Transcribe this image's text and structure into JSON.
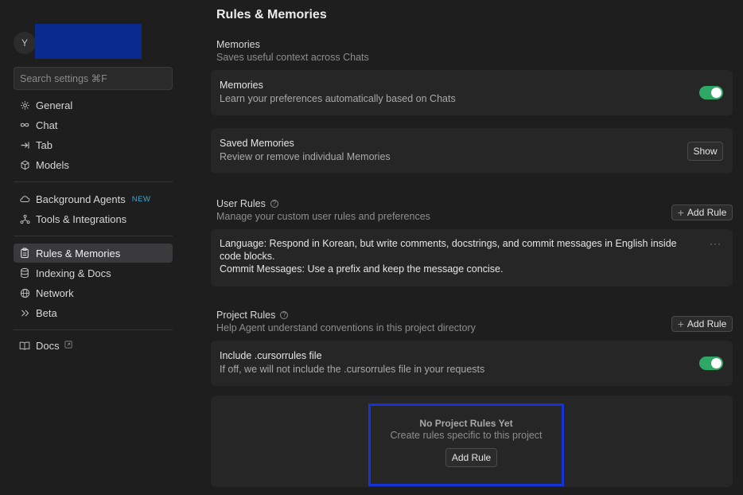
{
  "sidebar": {
    "avatar_initial": "Y",
    "search_placeholder": "Search settings ⌘F",
    "items": [
      {
        "label": "General",
        "icon": "gear-icon"
      },
      {
        "label": "Chat",
        "icon": "infinity-icon"
      },
      {
        "label": "Tab",
        "icon": "tab-arrow-icon"
      },
      {
        "label": "Models",
        "icon": "cube-icon"
      },
      {
        "label": "Background Agents",
        "icon": "cloud-icon",
        "badge": "NEW"
      },
      {
        "label": "Tools & Integrations",
        "icon": "tools-icon"
      },
      {
        "label": "Rules & Memories",
        "icon": "clipboard-icon",
        "active": true
      },
      {
        "label": "Indexing & Docs",
        "icon": "database-icon"
      },
      {
        "label": "Network",
        "icon": "globe-icon"
      },
      {
        "label": "Beta",
        "icon": "chevrons-right-icon"
      },
      {
        "label": "Docs",
        "icon": "book-icon",
        "external": true
      }
    ]
  },
  "main": {
    "title": "Rules & Memories",
    "memories_section": {
      "title": "Memories",
      "subtitle": "Saves useful context across Chats",
      "toggle_row": {
        "title": "Memories",
        "subtitle": "Learn your preferences automatically based on Chats",
        "enabled": true
      },
      "saved_row": {
        "title": "Saved Memories",
        "subtitle": "Review or remove individual Memories",
        "button": "Show"
      }
    },
    "user_rules": {
      "title": "User Rules",
      "subtitle": "Manage your custom user rules and preferences",
      "add_button": "Add Rule",
      "rule_line1": "Language: Respond in Korean, but write comments, docstrings, and commit messages in English inside code blocks.",
      "rule_line2": "Commit Messages: Use a prefix and keep the message concise.",
      "more": "···"
    },
    "project_rules": {
      "title": "Project Rules",
      "subtitle": "Help Agent understand conventions in this project directory",
      "add_button": "Add Rule",
      "cursorrules_row": {
        "title": "Include .cursorrules file",
        "subtitle": "If off, we will not include the .cursorrules file in your requests",
        "enabled": true
      },
      "empty": {
        "title": "No Project Rules Yet",
        "subtitle": "Create rules specific to this project",
        "button": "Add Rule"
      }
    }
  },
  "colors": {
    "toggle_on": "#2fa866",
    "highlight_box": "#1533d6",
    "new_badge": "#3aa8d8"
  }
}
